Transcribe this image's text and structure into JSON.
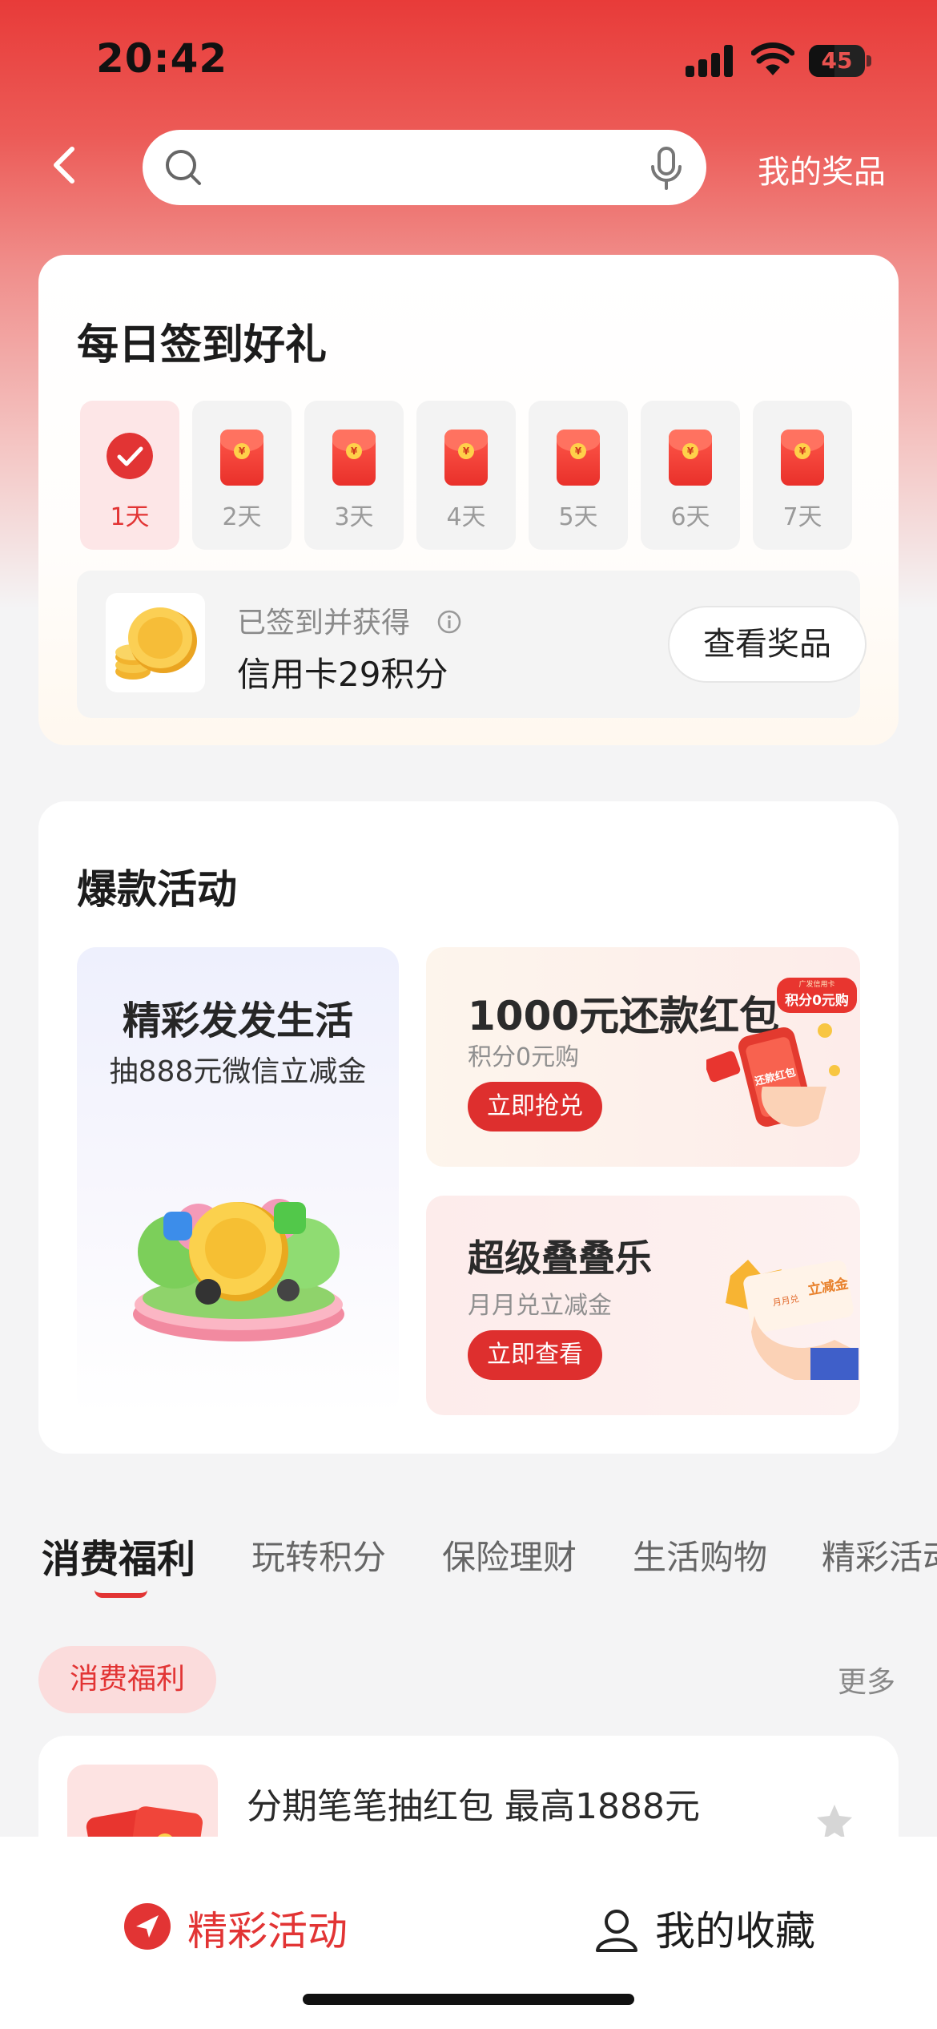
{
  "status_bar": {
    "time": "20:42",
    "battery": "45"
  },
  "nav": {
    "search_placeholder": "",
    "my_prizes": "我的奖品"
  },
  "checkin": {
    "title": "每日签到好礼",
    "days": [
      "1天",
      "2天",
      "3天",
      "4天",
      "5天",
      "6天",
      "7天"
    ],
    "reward_status": "已签到并获得",
    "reward_text": "信用卡29积分",
    "view_button": "查看奖品"
  },
  "activities": {
    "title": "爆款活动",
    "big_tile": {
      "title": "精彩发发生活",
      "subtitle": "抽888元微信立减金"
    },
    "promo_a": {
      "title": "1000元还款红包",
      "subtitle": "积分0元购",
      "button": "立即抢兑",
      "badge": "积分0元购",
      "badge_top": "广发信用卡",
      "art_text": "还款红包"
    },
    "promo_b": {
      "title": "超级叠叠乐",
      "subtitle": "月月兑立减金",
      "button": "立即查看",
      "card_small": "月月兑",
      "card_big": "立减金"
    }
  },
  "tabs": [
    "消费福利",
    "玩转积分",
    "保险理财",
    "生活购物",
    "精彩活动"
  ],
  "section": {
    "chip": "消费福利",
    "more": "更多"
  },
  "list": [
    {
      "title": "分期笔笔抽红包 最高1888元"
    }
  ],
  "bottom_nav": [
    {
      "label": "精彩活动",
      "active": true
    },
    {
      "label": "我的收藏",
      "active": false
    }
  ],
  "colors": {
    "accent": "#e23434",
    "header_red": "#e83b39"
  }
}
